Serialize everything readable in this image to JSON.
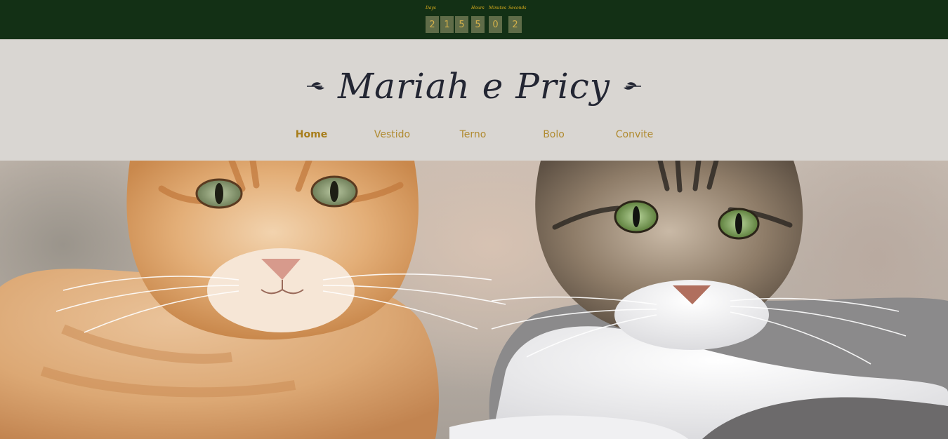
{
  "countdown": {
    "days": {
      "label": "Days",
      "digits": [
        "2",
        "1",
        "5"
      ]
    },
    "hours": {
      "label": "Hours",
      "digits": [
        "5"
      ]
    },
    "minutes": {
      "label": "Minutes",
      "digits": [
        "0"
      ]
    },
    "seconds": {
      "label": "Seconds",
      "digits": [
        "2"
      ]
    }
  },
  "header": {
    "title": "Mariah e Pricy"
  },
  "nav": {
    "items": [
      {
        "label": "Home",
        "active": true
      },
      {
        "label": "Vestido",
        "active": false
      },
      {
        "label": "Terno",
        "active": false
      },
      {
        "label": "Bolo",
        "active": false
      },
      {
        "label": "Convite",
        "active": false
      }
    ]
  },
  "colors": {
    "countdown_bg": "#133015",
    "countdown_digit_bg": "#5f6c48",
    "countdown_label": "#e0b21c",
    "header_bg": "#d9d6d2",
    "nav_text": "#b08a2f",
    "title_text": "#232633"
  },
  "hero": {
    "image": "two-cats-photo"
  }
}
